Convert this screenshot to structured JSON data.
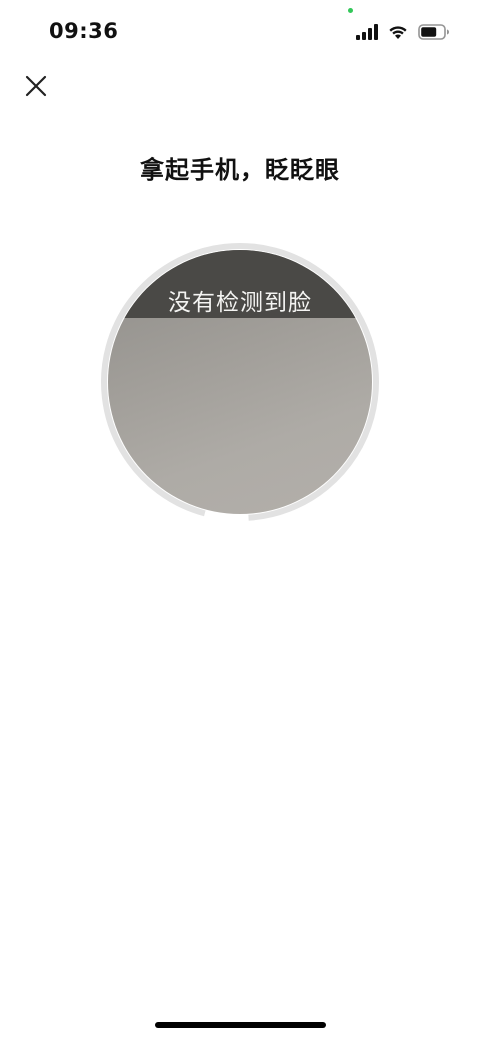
{
  "status_bar": {
    "time": "09:36",
    "icons": [
      "signal-icon",
      "wifi-icon",
      "battery-icon"
    ],
    "privacy_indicator_color": "#33c759"
  },
  "header": {
    "close_icon": "close-icon"
  },
  "title": "拿起手机，眨眨眼",
  "camera": {
    "status_text": "没有检测到脸",
    "progress_ring_color": "#dddddd"
  },
  "colors": {
    "background": "#ffffff",
    "banner": "#4a4946",
    "text": "#111111"
  }
}
